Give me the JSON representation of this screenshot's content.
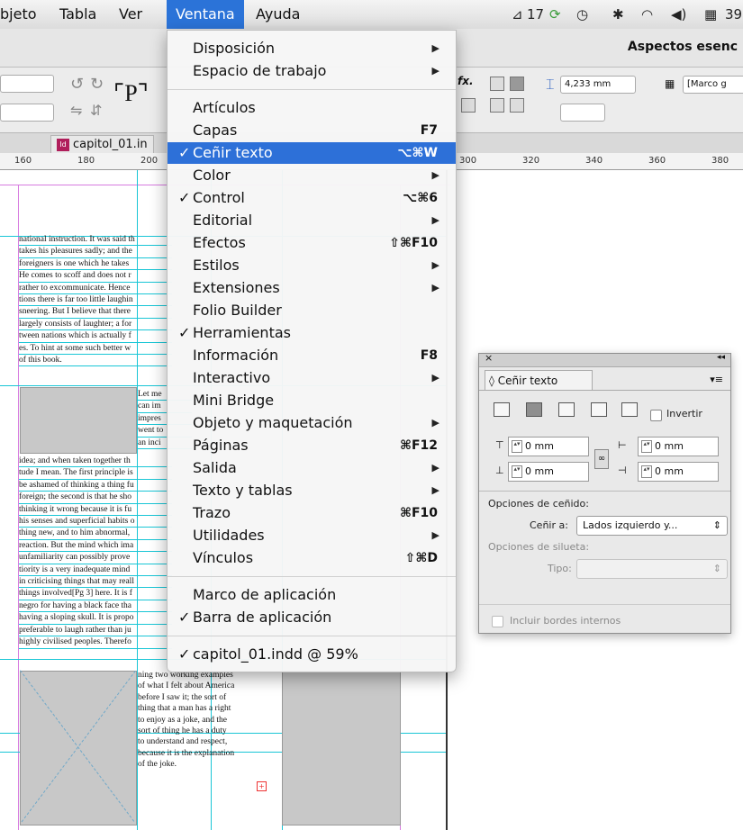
{
  "menubar": {
    "items": [
      "bjeto",
      "Tabla",
      "Ver",
      "Ventana",
      "Ayuda"
    ],
    "status": {
      "ai_badge": "17"
    }
  },
  "appbar": {
    "workspace": "Aspectos esenc"
  },
  "control": {
    "fx": "fx.",
    "dimension": "4,233 mm",
    "style_field": "[Marco g"
  },
  "doc_tab": "capitol_01.in",
  "ruler": [
    "160",
    "180",
    "200",
    "300",
    "320",
    "340",
    "360",
    "380"
  ],
  "body_text": {
    "a": [
      "national instruction. It was said th",
      "takes his pleasures sadly; and the",
      "foreigners is one which he takes",
      "He comes to scoff and does not r",
      "rather to excommunicate. Hence",
      "tions there is far too little laughin",
      "sneering. But I believe that there",
      "largely consists of laughter; a for",
      "tween nations which is actually f",
      "es. To hint at some such better w",
      "of this book."
    ],
    "b": [
      "Let me",
      "can im",
      "impres",
      "went to",
      "an inci"
    ],
    "c": [
      "idea; and when taken together th",
      "tude I mean. The first principle is",
      "be ashamed of thinking a thing fu",
      "foreign; the second is that he sho",
      "thinking it wrong because it is fu",
      "his senses and superficial habits o",
      "thing new, and to him abnormal,",
      "reaction. But the mind which ima",
      "unfamiliarity can possibly prove",
      "tiority is a very inadequate mind",
      "in criticising things that may reall",
      "things involved[Pg 3] here. It is f",
      "negro for having a black face tha",
      "having a sloping skull. It is propo",
      "preferable to laugh rather than ju",
      "highly civilised peoples. Therefo"
    ],
    "d": [
      "ning two working examples",
      "of what I felt about America",
      "before I saw it; the sort of",
      "thing that a man has a right",
      "to enjoy as a joke, and the",
      "sort of thing he has a duty",
      "to understand and respect,",
      "because it is the explanation",
      "of the joke."
    ]
  },
  "menu": [
    {
      "label": "Disposición",
      "sub": true
    },
    {
      "label": "Espacio de trabajo",
      "sub": true
    },
    {
      "sep": true
    },
    {
      "label": "Artículos"
    },
    {
      "label": "Capas",
      "shortcut": "F7"
    },
    {
      "label": "Ceñir texto",
      "checked": true,
      "highlighted": true,
      "shortcut": "⌥⌘W"
    },
    {
      "label": "Color",
      "sub": true
    },
    {
      "label": "Control",
      "checked": true,
      "shortcut": "⌥⌘6"
    },
    {
      "label": "Editorial",
      "sub": true
    },
    {
      "label": "Efectos",
      "shortcut": "⇧⌘F10"
    },
    {
      "label": "Estilos",
      "sub": true
    },
    {
      "label": "Extensiones",
      "sub": true
    },
    {
      "label": "Folio Builder"
    },
    {
      "label": "Herramientas",
      "checked": true
    },
    {
      "label": "Información",
      "shortcut": "F8"
    },
    {
      "label": "Interactivo",
      "sub": true
    },
    {
      "label": "Mini Bridge"
    },
    {
      "label": "Objeto y maquetación",
      "sub": true
    },
    {
      "label": "Páginas",
      "shortcut": "⌘F12"
    },
    {
      "label": "Salida",
      "sub": true
    },
    {
      "label": "Texto y tablas",
      "sub": true
    },
    {
      "label": "Trazo",
      "shortcut": "⌘F10"
    },
    {
      "label": "Utilidades",
      "sub": true
    },
    {
      "label": "Vínculos",
      "shortcut": "⇧⌘D"
    },
    {
      "sep": true
    },
    {
      "label": "Marco de aplicación"
    },
    {
      "label": "Barra de aplicación",
      "checked": true
    },
    {
      "sep": true
    },
    {
      "label": "capitol_01.indd @ 59%",
      "checked": true
    }
  ],
  "panel": {
    "tab": "Ceñir texto",
    "invert": "Invertir",
    "offset_top": "0 mm",
    "offset_bottom": "0 mm",
    "offset_left": "0 mm",
    "offset_right": "0 mm",
    "wrap_options_title": "Opciones de ceñido:",
    "wrap_to_label": "Ceñir a:",
    "wrap_to_value": "Lados izquierdo y...",
    "contour_title": "Opciones de silueta:",
    "type_label": "Tipo:",
    "include_inside": "Incluir bordes internos"
  },
  "colors": {
    "menu_highlight": "#2d70d8",
    "guide": "#19c6d6",
    "margin": "#d77be0"
  }
}
